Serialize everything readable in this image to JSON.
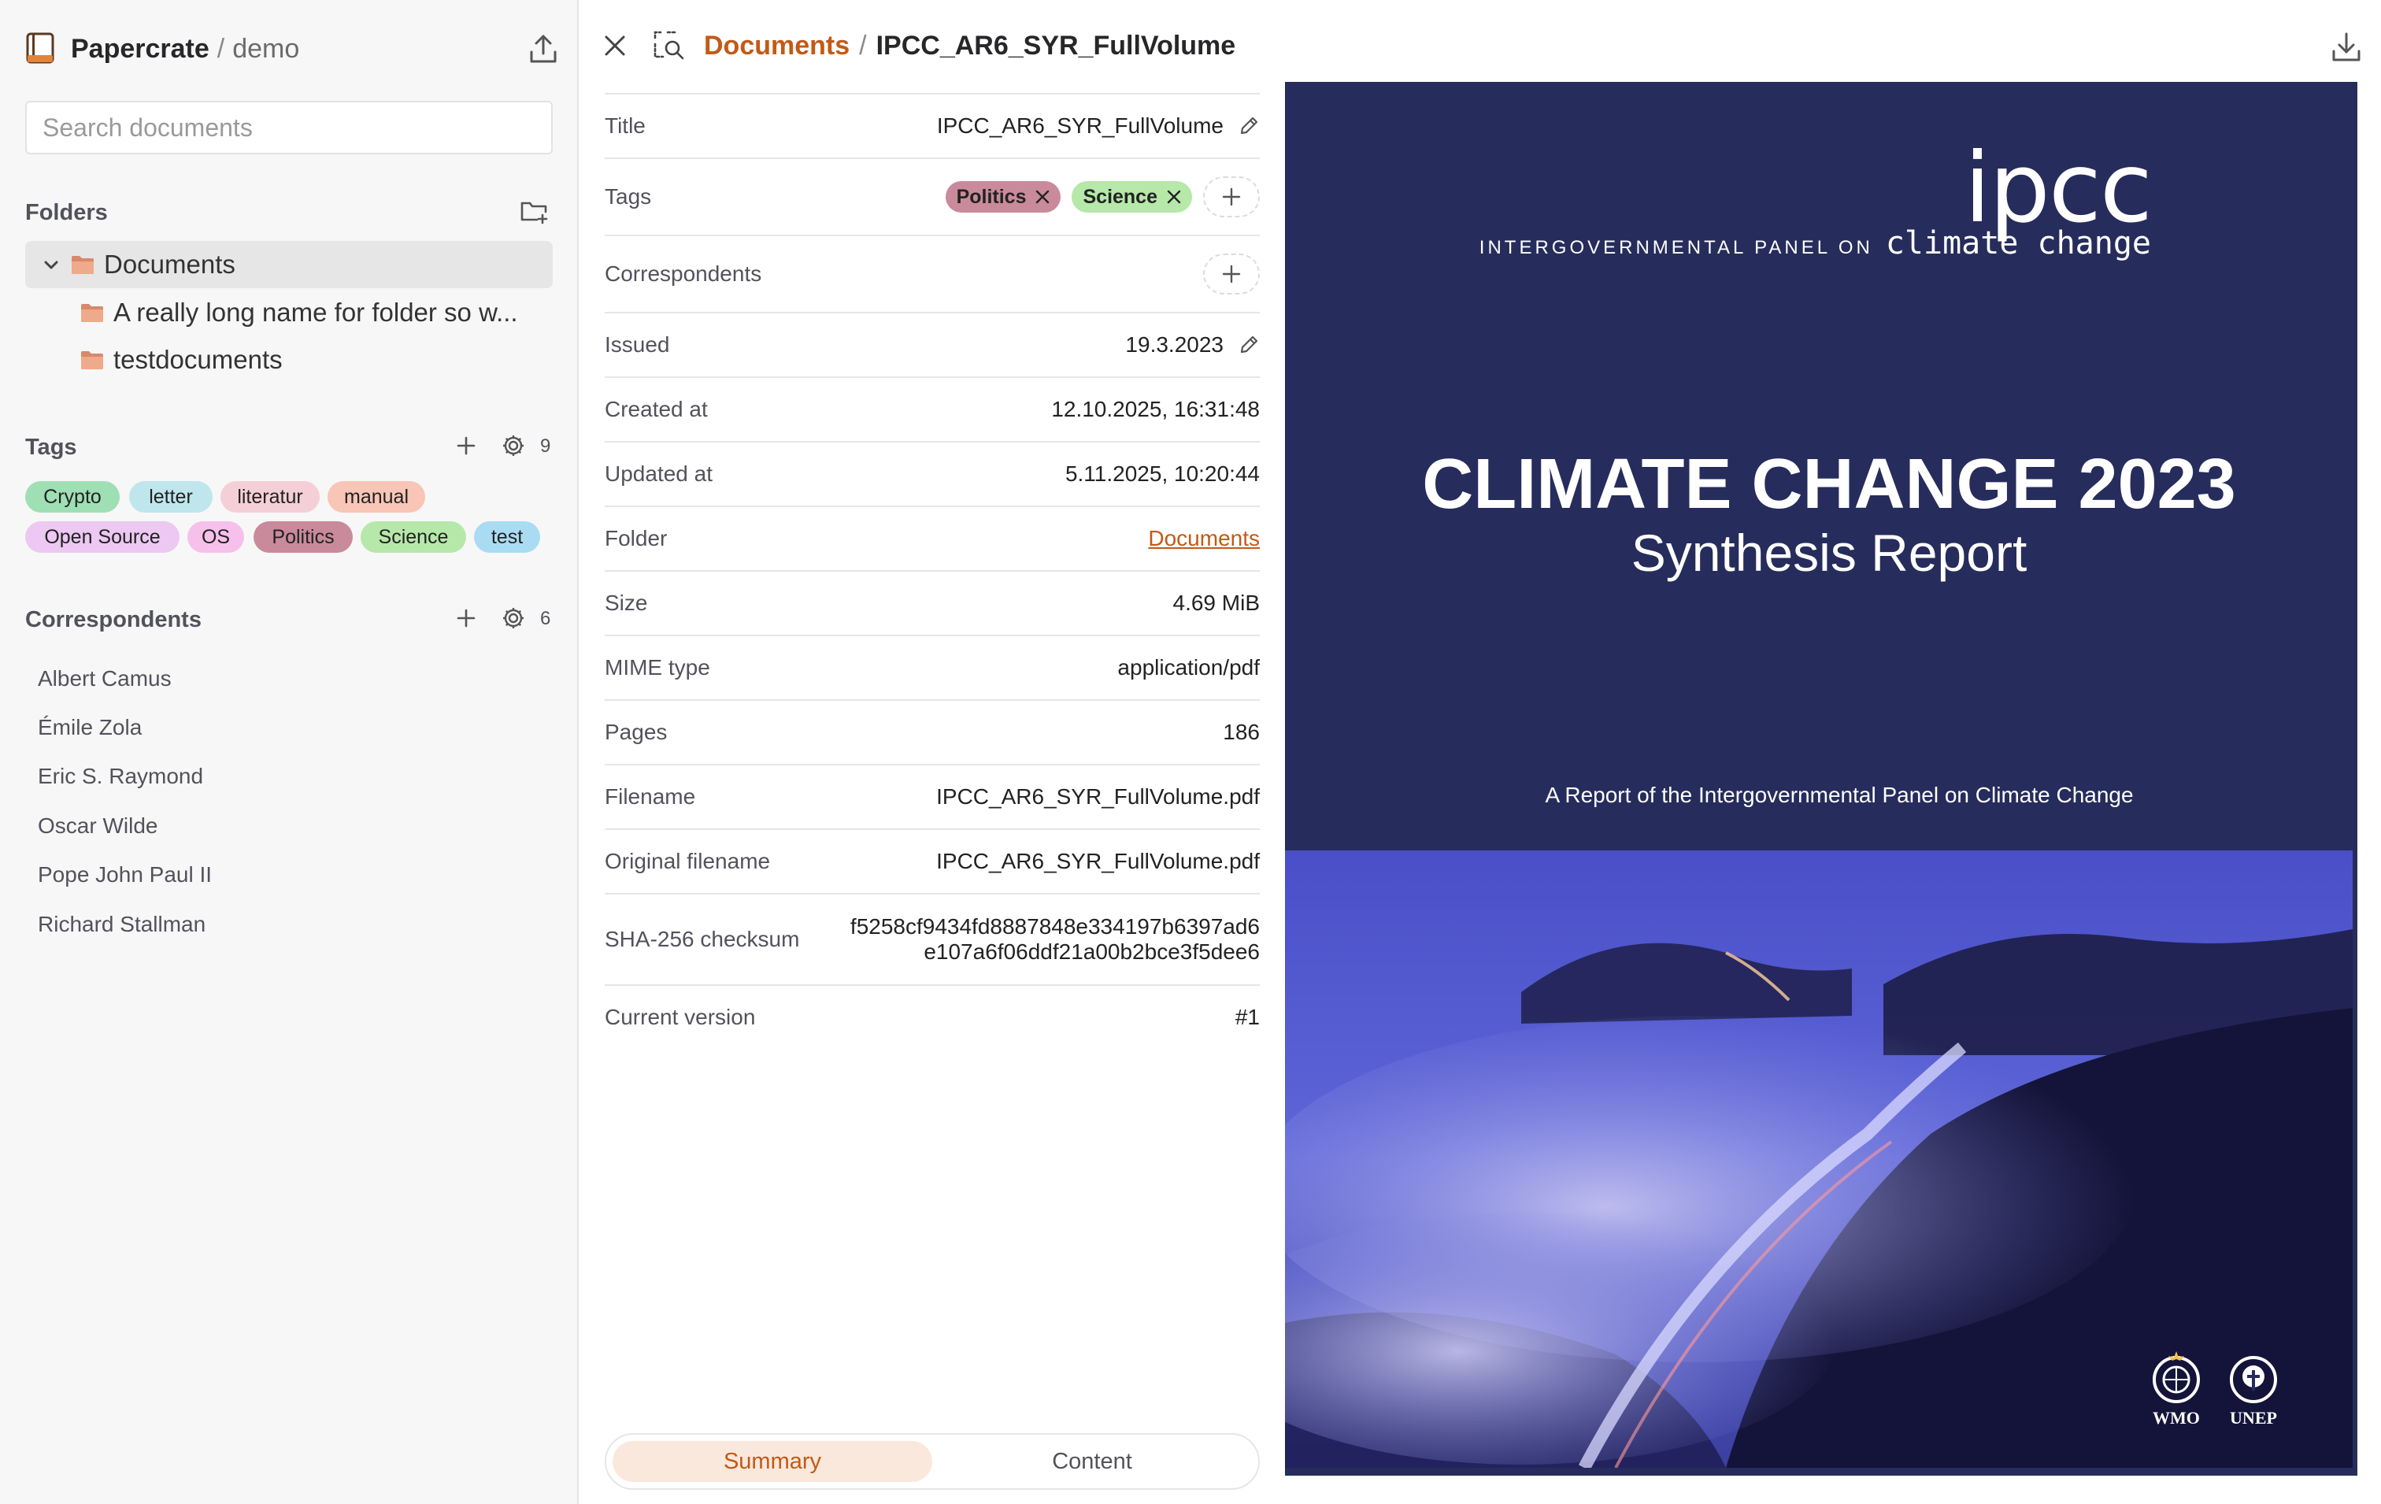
{
  "sidebar": {
    "app_name": "Papercrate",
    "separator": "/",
    "user": "demo",
    "search": {
      "placeholder": "Search documents",
      "value": ""
    },
    "folders": {
      "title": "Folders",
      "active": "Documents",
      "children": [
        "A really long name for folder so w...",
        "testdocuments"
      ]
    },
    "tags": {
      "title": "Tags",
      "count": "9",
      "items": [
        {
          "label": "Crypto",
          "color": "#9fdfb4"
        },
        {
          "label": "letter",
          "color": "#bfe6ec"
        },
        {
          "label": "literatur",
          "color": "#f5cfd8"
        },
        {
          "label": "manual",
          "color": "#f8c5b6"
        },
        {
          "label": "Open Source",
          "color": "#ecc8f2"
        },
        {
          "label": "OS",
          "color": "#f6c0ea"
        },
        {
          "label": "Politics",
          "color": "#c98a9c"
        },
        {
          "label": "Science",
          "color": "#b6e8a9"
        },
        {
          "label": "test",
          "color": "#a9dcf3"
        }
      ]
    },
    "correspondents": {
      "title": "Correspondents",
      "count": "6",
      "items": [
        "Albert Camus",
        "Émile Zola",
        "Eric S. Raymond",
        "Oscar Wilde",
        "Pope John Paul II",
        "Richard Stallman"
      ]
    }
  },
  "header": {
    "breadcrumb_root": "Documents",
    "breadcrumb_sep": "/",
    "breadcrumb_current": "IPCC_AR6_SYR_FullVolume"
  },
  "meta": {
    "title": {
      "label": "Title",
      "value": "IPCC_AR6_SYR_FullVolume"
    },
    "tags": {
      "label": "Tags",
      "chips": [
        {
          "label": "Politics",
          "color": "#c98a9c"
        },
        {
          "label": "Science",
          "color": "#b6e8a9"
        }
      ]
    },
    "correspondents": {
      "label": "Correspondents"
    },
    "issued": {
      "label": "Issued",
      "value": "19.3.2023"
    },
    "created": {
      "label": "Created at",
      "value": "12.10.2025, 16:31:48"
    },
    "updated": {
      "label": "Updated at",
      "value": "5.11.2025, 10:20:44"
    },
    "folder": {
      "label": "Folder",
      "value": "Documents"
    },
    "size": {
      "label": "Size",
      "value": "4.69 MiB"
    },
    "mime": {
      "label": "MIME type",
      "value": "application/pdf"
    },
    "pages": {
      "label": "Pages",
      "value": "186"
    },
    "filename": {
      "label": "Filename",
      "value": "IPCC_AR6_SYR_FullVolume.pdf"
    },
    "original_filename": {
      "label": "Original filename",
      "value": "IPCC_AR6_SYR_FullVolume.pdf"
    },
    "checksum": {
      "label": "SHA-256 checksum",
      "line1": "f5258cf9434fd8887848e334197b6397ad6",
      "line2": "e107a6f06ddf21a00b2bce3f5dee6"
    },
    "version": {
      "label": "Current version",
      "value": "#1"
    }
  },
  "bottom_tabs": {
    "summary": "Summary",
    "content": "Content",
    "active": "Summary"
  },
  "preview": {
    "logo": "ipcc",
    "logo_sub_a": "INTERGOVERNMENTAL PANEL ON",
    "logo_sub_b": "climate change",
    "title": "CLIMATE CHANGE 2023",
    "subtitle": "Synthesis Report",
    "report_line": "A Report of the Intergovernmental Panel on Climate Change",
    "partner1": "WMO",
    "partner2": "UNEP"
  },
  "colors": {
    "accent": "#c25a16",
    "cover_bg": "#262d5c"
  }
}
